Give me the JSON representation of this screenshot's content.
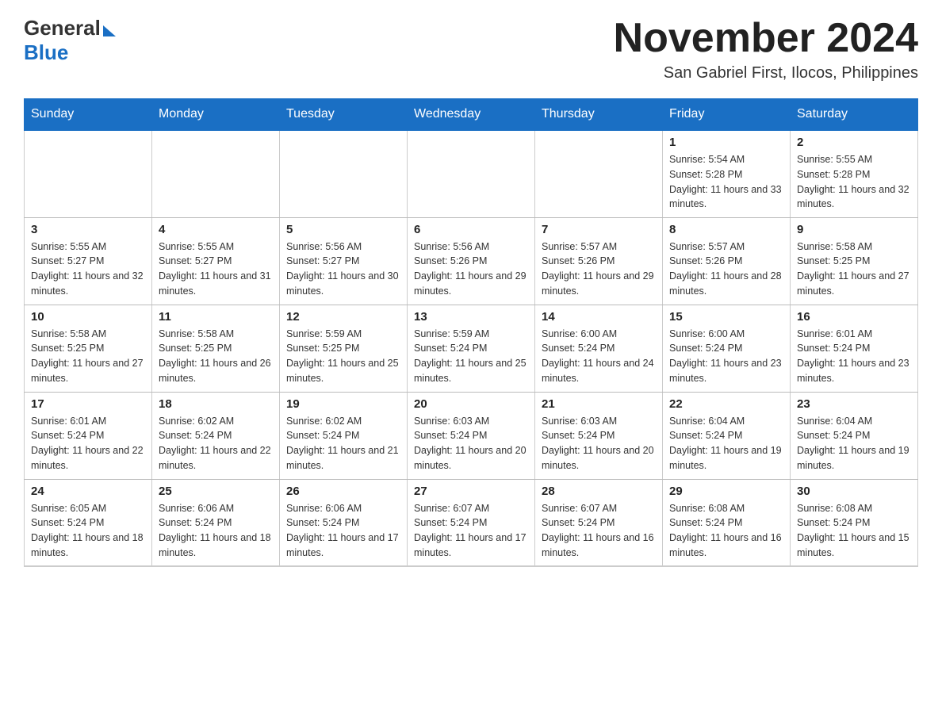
{
  "header": {
    "logo_general": "General",
    "logo_blue": "Blue",
    "month_title": "November 2024",
    "location": "San Gabriel First, Ilocos, Philippines"
  },
  "weekdays": [
    "Sunday",
    "Monday",
    "Tuesday",
    "Wednesday",
    "Thursday",
    "Friday",
    "Saturday"
  ],
  "weeks": [
    [
      {
        "day": "",
        "info": ""
      },
      {
        "day": "",
        "info": ""
      },
      {
        "day": "",
        "info": ""
      },
      {
        "day": "",
        "info": ""
      },
      {
        "day": "",
        "info": ""
      },
      {
        "day": "1",
        "info": "Sunrise: 5:54 AM\nSunset: 5:28 PM\nDaylight: 11 hours and 33 minutes."
      },
      {
        "day": "2",
        "info": "Sunrise: 5:55 AM\nSunset: 5:28 PM\nDaylight: 11 hours and 32 minutes."
      }
    ],
    [
      {
        "day": "3",
        "info": "Sunrise: 5:55 AM\nSunset: 5:27 PM\nDaylight: 11 hours and 32 minutes."
      },
      {
        "day": "4",
        "info": "Sunrise: 5:55 AM\nSunset: 5:27 PM\nDaylight: 11 hours and 31 minutes."
      },
      {
        "day": "5",
        "info": "Sunrise: 5:56 AM\nSunset: 5:27 PM\nDaylight: 11 hours and 30 minutes."
      },
      {
        "day": "6",
        "info": "Sunrise: 5:56 AM\nSunset: 5:26 PM\nDaylight: 11 hours and 29 minutes."
      },
      {
        "day": "7",
        "info": "Sunrise: 5:57 AM\nSunset: 5:26 PM\nDaylight: 11 hours and 29 minutes."
      },
      {
        "day": "8",
        "info": "Sunrise: 5:57 AM\nSunset: 5:26 PM\nDaylight: 11 hours and 28 minutes."
      },
      {
        "day": "9",
        "info": "Sunrise: 5:58 AM\nSunset: 5:25 PM\nDaylight: 11 hours and 27 minutes."
      }
    ],
    [
      {
        "day": "10",
        "info": "Sunrise: 5:58 AM\nSunset: 5:25 PM\nDaylight: 11 hours and 27 minutes."
      },
      {
        "day": "11",
        "info": "Sunrise: 5:58 AM\nSunset: 5:25 PM\nDaylight: 11 hours and 26 minutes."
      },
      {
        "day": "12",
        "info": "Sunrise: 5:59 AM\nSunset: 5:25 PM\nDaylight: 11 hours and 25 minutes."
      },
      {
        "day": "13",
        "info": "Sunrise: 5:59 AM\nSunset: 5:24 PM\nDaylight: 11 hours and 25 minutes."
      },
      {
        "day": "14",
        "info": "Sunrise: 6:00 AM\nSunset: 5:24 PM\nDaylight: 11 hours and 24 minutes."
      },
      {
        "day": "15",
        "info": "Sunrise: 6:00 AM\nSunset: 5:24 PM\nDaylight: 11 hours and 23 minutes."
      },
      {
        "day": "16",
        "info": "Sunrise: 6:01 AM\nSunset: 5:24 PM\nDaylight: 11 hours and 23 minutes."
      }
    ],
    [
      {
        "day": "17",
        "info": "Sunrise: 6:01 AM\nSunset: 5:24 PM\nDaylight: 11 hours and 22 minutes."
      },
      {
        "day": "18",
        "info": "Sunrise: 6:02 AM\nSunset: 5:24 PM\nDaylight: 11 hours and 22 minutes."
      },
      {
        "day": "19",
        "info": "Sunrise: 6:02 AM\nSunset: 5:24 PM\nDaylight: 11 hours and 21 minutes."
      },
      {
        "day": "20",
        "info": "Sunrise: 6:03 AM\nSunset: 5:24 PM\nDaylight: 11 hours and 20 minutes."
      },
      {
        "day": "21",
        "info": "Sunrise: 6:03 AM\nSunset: 5:24 PM\nDaylight: 11 hours and 20 minutes."
      },
      {
        "day": "22",
        "info": "Sunrise: 6:04 AM\nSunset: 5:24 PM\nDaylight: 11 hours and 19 minutes."
      },
      {
        "day": "23",
        "info": "Sunrise: 6:04 AM\nSunset: 5:24 PM\nDaylight: 11 hours and 19 minutes."
      }
    ],
    [
      {
        "day": "24",
        "info": "Sunrise: 6:05 AM\nSunset: 5:24 PM\nDaylight: 11 hours and 18 minutes."
      },
      {
        "day": "25",
        "info": "Sunrise: 6:06 AM\nSunset: 5:24 PM\nDaylight: 11 hours and 18 minutes."
      },
      {
        "day": "26",
        "info": "Sunrise: 6:06 AM\nSunset: 5:24 PM\nDaylight: 11 hours and 17 minutes."
      },
      {
        "day": "27",
        "info": "Sunrise: 6:07 AM\nSunset: 5:24 PM\nDaylight: 11 hours and 17 minutes."
      },
      {
        "day": "28",
        "info": "Sunrise: 6:07 AM\nSunset: 5:24 PM\nDaylight: 11 hours and 16 minutes."
      },
      {
        "day": "29",
        "info": "Sunrise: 6:08 AM\nSunset: 5:24 PM\nDaylight: 11 hours and 16 minutes."
      },
      {
        "day": "30",
        "info": "Sunrise: 6:08 AM\nSunset: 5:24 PM\nDaylight: 11 hours and 15 minutes."
      }
    ]
  ]
}
